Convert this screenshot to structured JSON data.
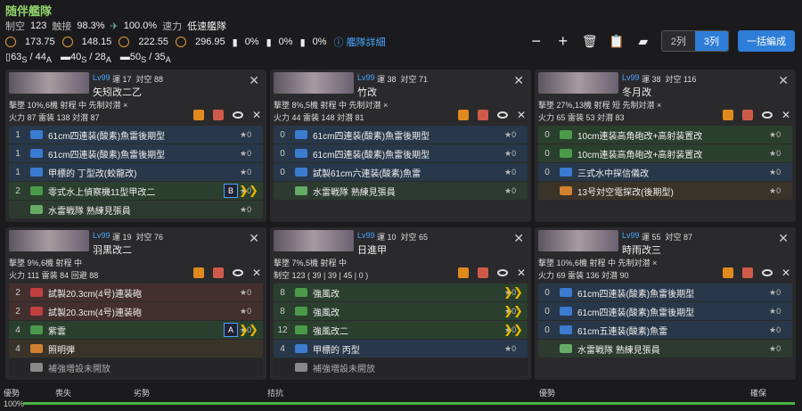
{
  "fleet": {
    "title": "随伴艦隊",
    "air_label": "制空",
    "air": "123",
    "los_label": "触接",
    "los": "98.3%",
    "ctr": "100.0%",
    "speed_label": "速力",
    "speed": "低速艦隊",
    "los_values": [
      "173.75",
      "148.15",
      "222.55",
      "296.95"
    ],
    "pct": [
      "0%",
      "0%",
      "0%"
    ],
    "detail": "艦隊詳細",
    "tp": "63",
    "tp_sub_s": "S",
    "tp_a": "44",
    "tp_sub_a": "A",
    "tp2": "40",
    "tp2_s": "S",
    "tp2_a": "28",
    "tp2_sub_a": "A",
    "tp3": "50",
    "tp3_s": "S",
    "tp3_a": "35",
    "tp3_sub_a": "A",
    "cols2": "2列",
    "cols3": "3列",
    "bulk": "一括編成"
  },
  "ships": [
    {
      "name": "矢矧改二乙",
      "lv": "Lv99",
      "luck": "運 17",
      "aa": "対空 88",
      "r2": "撃墜 10%,6機 射程 中 先制対潜 ×",
      "r3": "火力 87 雷装 138 対潜 87",
      "slots": [
        [
          "1",
          "61cm四連装(酸素)魚雷後期型",
          "★0"
        ],
        [
          "1",
          "61cm四連装(酸素)魚雷後期型",
          "★0"
        ],
        [
          "1",
          "甲標的 丁型改(蛟龍改)",
          "★0"
        ],
        [
          "2",
          "零式水上偵察機11型甲改二",
          "★0"
        ],
        [
          "",
          "水雷戦隊 熟練見張員",
          "★0"
        ]
      ],
      "pf": "B"
    },
    {
      "name": "竹改",
      "lv": "Lv99",
      "luck": "運 38",
      "aa": "対空 71",
      "r2": "撃墜 8%,5機 射程 中 先制対潜 ×",
      "r3": "火力 44 雷装 148 対潜 81",
      "slots": [
        [
          "0",
          "61cm四連装(酸素)魚雷後期型",
          "★0"
        ],
        [
          "0",
          "61cm四連装(酸素)魚雷後期型",
          "★0"
        ],
        [
          "0",
          "試製61cm六連装(酸素)魚雷",
          "★0"
        ],
        [
          "",
          "水雷戦隊 熟練見張員",
          "★0"
        ]
      ]
    },
    {
      "name": "冬月改",
      "lv": "Lv99",
      "luck": "運 38",
      "aa": "対空 116",
      "r2": "撃墜 27%,13機 射程 短 先制対潜 ×",
      "r3": "火力 65 雷装 53 対潜 83",
      "slots": [
        [
          "0",
          "10cm連装高角砲改+高射装置改",
          "★0"
        ],
        [
          "0",
          "10cm連装高角砲改+高射装置改",
          "★0"
        ],
        [
          "0",
          "三式水中探信儀改",
          "★0"
        ],
        [
          "",
          "13号対空電探改(後期型)",
          "★0"
        ]
      ]
    },
    {
      "name": "羽黒改二",
      "lv": "Lv99",
      "luck": "運 19",
      "aa": "対空 76",
      "r2": "撃墜 9%,6機 射程 中",
      "r3": "火力 111 雷装 84 回避 88",
      "slots": [
        [
          "2",
          "試製20.3cm(4号)連装砲",
          "★0"
        ],
        [
          "2",
          "試製20.3cm(4号)連装砲",
          "★0"
        ],
        [
          "4",
          "紫雲",
          "★0"
        ],
        [
          "4",
          "照明弾",
          ""
        ],
        [
          "",
          "補強増設未開放",
          ""
        ]
      ],
      "pf": "A"
    },
    {
      "name": "日進甲",
      "lv": "Lv99",
      "luck": "運 10",
      "aa": "対空 65",
      "r2": "撃墜 7%,5機 射程 中",
      "r3": "制空 123 ( 39 | 39 | 45 | 0 )",
      "slots": [
        [
          "8",
          "強風改",
          "★0"
        ],
        [
          "8",
          "強風改",
          "★0"
        ],
        [
          "12",
          "強風改二",
          "★0"
        ],
        [
          "4",
          "甲標的 丙型",
          "★0"
        ],
        [
          "",
          "補強増設未開放",
          ""
        ]
      ]
    },
    {
      "name": "時雨改三",
      "lv": "Lv99",
      "luck": "運 55",
      "aa": "対空 87",
      "r2": "撃墜 10%,6機 射程 中 先制対潜 ×",
      "r3": "火力 69 雷装 136 対潜 90",
      "slots": [
        [
          "0",
          "61cm四連装(酸素)魚雷後期型",
          "★0"
        ],
        [
          "0",
          "61cm四連装(酸素)魚雷後期型",
          "★0"
        ],
        [
          "0",
          "61cm五連装(酸素)魚雷",
          "★0"
        ],
        [
          "",
          "水雷戦隊 熟練見張員",
          "★0"
        ]
      ]
    }
  ],
  "bottom": {
    "l1": "優勢",
    "l2": "喪失",
    "l3": "劣勢",
    "l4": "拮抗",
    "l5": "優勢",
    "l6": "確保",
    "pct": "100%"
  }
}
